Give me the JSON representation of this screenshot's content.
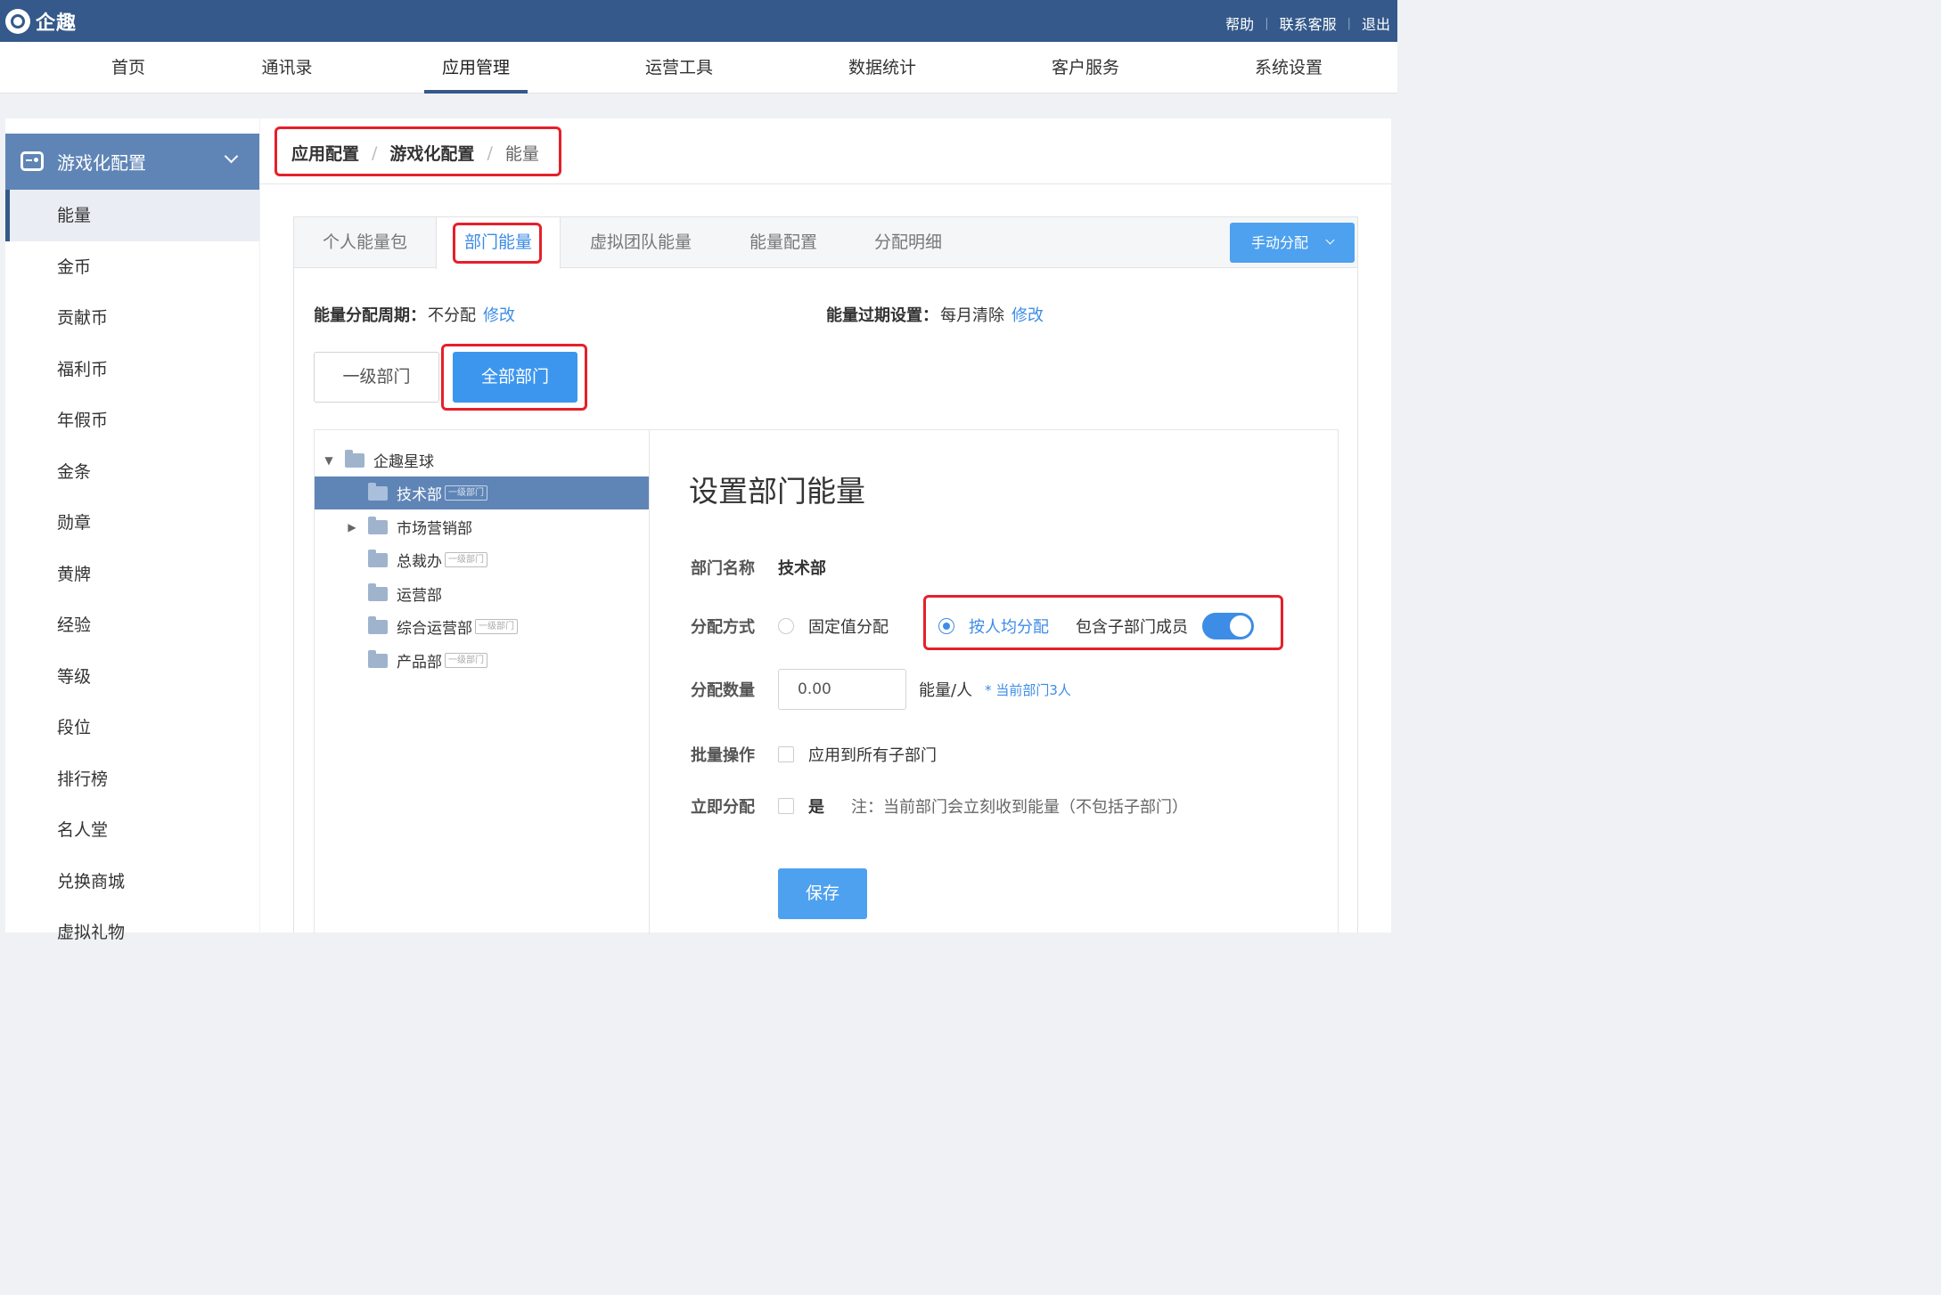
{
  "app": {
    "name": "企趣"
  },
  "toplinks": {
    "help": "帮助",
    "support": "联系客服",
    "logout": "退出",
    "sep": "|"
  },
  "nav": [
    "首页",
    "通讯录",
    "应用管理",
    "运营工具",
    "数据统计",
    "客户服务",
    "系统设置"
  ],
  "nav_active": "应用管理",
  "sidebar": {
    "section": "游戏化配置",
    "items": [
      "能量",
      "金币",
      "贡献币",
      "福利币",
      "年假币",
      "金条",
      "勋章",
      "黄牌",
      "经验",
      "等级",
      "段位",
      "排行榜",
      "名人堂",
      "兑换商城",
      "虚拟礼物"
    ],
    "active": "能量"
  },
  "breadcrumb": {
    "l1": "应用配置",
    "l2": "游戏化配置",
    "l3": "能量",
    "sep": "/"
  },
  "tabs": [
    "个人能量包",
    "部门能量",
    "虚拟团队能量",
    "能量配置",
    "分配明细"
  ],
  "tab_active": "部门能量",
  "manual_button": "手动分配",
  "config": {
    "cycle_label": "能量分配周期：",
    "cycle_value": "不分配",
    "cycle_link": "修改",
    "expire_label": "能量过期设置：",
    "expire_value": "每月清除",
    "expire_link": "修改"
  },
  "dept_filter": {
    "level1": "一级部门",
    "all": "全部部门",
    "active": "全部部门"
  },
  "tree": {
    "root": "企趣星球",
    "tag": "一级部门",
    "nodes": [
      {
        "name": "技术部",
        "tagged": true,
        "selected": true,
        "expandable": false
      },
      {
        "name": "市场营销部",
        "tagged": false,
        "selected": false,
        "expandable": true
      },
      {
        "name": "总裁办",
        "tagged": true,
        "selected": false,
        "expandable": false
      },
      {
        "name": "运营部",
        "tagged": false,
        "selected": false,
        "expandable": false
      },
      {
        "name": "综合运营部",
        "tagged": true,
        "selected": false,
        "expandable": false
      },
      {
        "name": "产品部",
        "tagged": true,
        "selected": false,
        "expandable": false
      }
    ]
  },
  "form": {
    "title": "设置部门能量",
    "dept_label": "部门名称",
    "dept_value": "技术部",
    "method_label": "分配方式",
    "method_fixed": "固定值分配",
    "method_avg": "按人均分配",
    "method_selected": "按人均分配",
    "include_sub": "包含子部门成员",
    "include_sub_on": true,
    "amount_label": "分配数量",
    "amount_value": "0.00",
    "amount_unit": "能量/人",
    "amount_hint": "* 当前部门3人",
    "batch_label": "批量操作",
    "batch_option": "应用到所有子部门",
    "batch_checked": false,
    "now_label": "立即分配",
    "now_option": "是",
    "now_checked": false,
    "now_note": "注：当前部门会立刻收到能量（不包括子部门）",
    "save": "保存"
  },
  "colors": {
    "topbar": "#34598a",
    "accent": "#3d8ce6",
    "button": "#4ea1ee",
    "highlight": "#e5202a",
    "sidebar_head": "#5f85b6"
  }
}
